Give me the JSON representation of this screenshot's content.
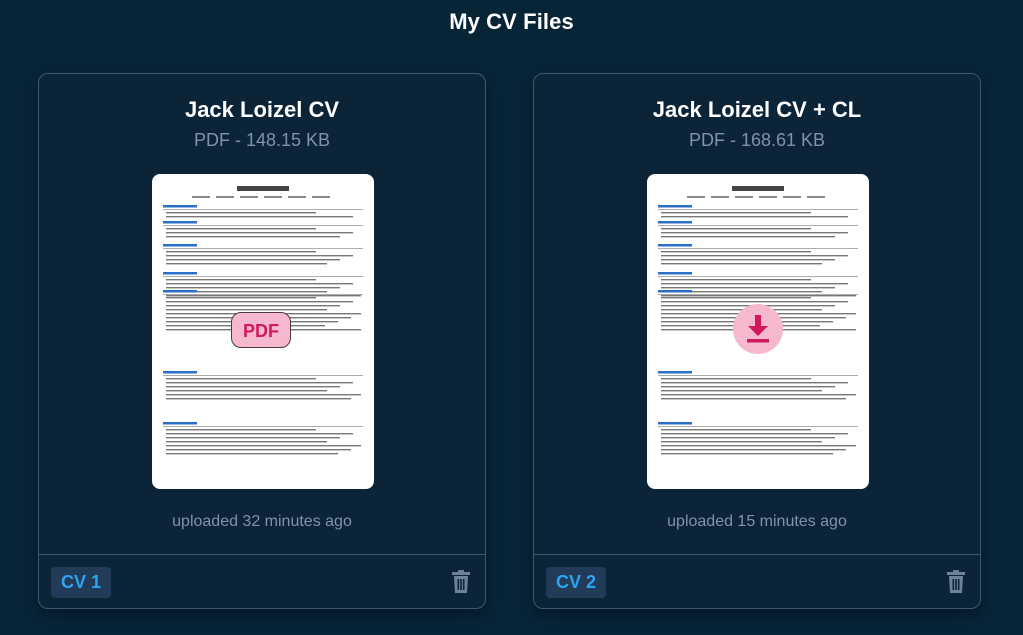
{
  "page": {
    "title": "My CV Files"
  },
  "cards": [
    {
      "title": "Jack Loizel CV",
      "meta": "PDF - 148.15 KB",
      "uploaded": "uploaded 32 minutes ago",
      "chip": "CV 1",
      "thumbnail_badge": "PDF",
      "hover_state": "file-type-badge"
    },
    {
      "title": "Jack Loizel CV + CL",
      "meta": "PDF - 168.61 KB",
      "uploaded": "uploaded 15 minutes ago",
      "chip": "CV 2",
      "hover_state": "download-icon"
    }
  ],
  "icons": {
    "trash": "trash-icon",
    "download": "download-icon"
  },
  "colors": {
    "background": "#082538",
    "card_border": "#3d5870",
    "chip_bg": "#213b59",
    "chip_text": "#2ea3f2",
    "accent_pink": "#f5b8cf",
    "accent_red": "#d11a5c",
    "muted_text": "#8193aa"
  }
}
